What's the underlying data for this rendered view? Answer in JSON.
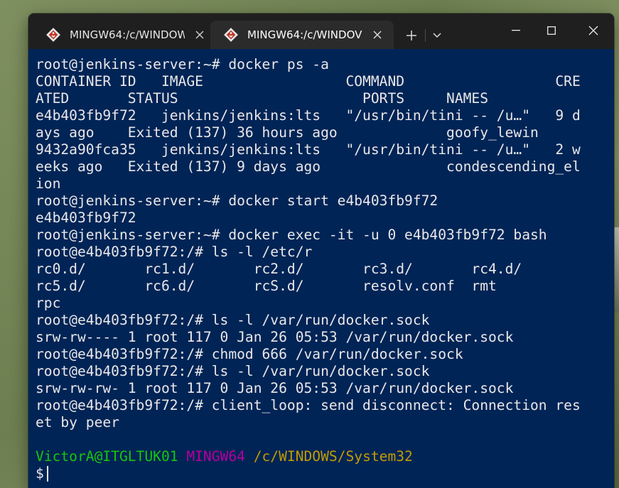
{
  "window": {
    "tabs": [
      {
        "title": "MINGW64:/c/WINDOW",
        "active": false
      },
      {
        "title": "MINGW64:/c/WINDOV",
        "active": true
      }
    ]
  },
  "colors": {
    "terminal_bg": "#012456",
    "prompt_user": "#16c60c",
    "prompt_system": "#b4009e",
    "prompt_path": "#c19c00"
  },
  "terminal": {
    "lines": [
      "root@jenkins-server:~# docker ps -a",
      "CONTAINER ID   IMAGE                 COMMAND                  CRE",
      "ATED       STATUS                      PORTS     NAMES",
      "e4b403fb9f72   jenkins/jenkins:lts   \"/usr/bin/tini -- /u…\"   9 d",
      "ays ago    Exited (137) 36 hours ago             goofy_lewin",
      "9432a90fca35   jenkins/jenkins:lts   \"/usr/bin/tini -- /u…\"   2 w",
      "eeks ago   Exited (137) 9 days ago               condescending_el",
      "ion",
      "root@jenkins-server:~# docker start e4b403fb9f72",
      "e4b403fb9f72",
      "root@jenkins-server:~# docker exec -it -u 0 e4b403fb9f72 bash",
      "root@e4b403fb9f72:/# ls -l /etc/r",
      "rc0.d/       rc1.d/       rc2.d/       rc3.d/       rc4.d/",
      "rc5.d/       rc6.d/       rcS.d/       resolv.conf  rmt",
      "rpc",
      "root@e4b403fb9f72:/# ls -l /var/run/docker.sock",
      "srw-rw---- 1 root 117 0 Jan 26 05:53 /var/run/docker.sock",
      "root@e4b403fb9f72:/# chmod 666 /var/run/docker.sock",
      "root@e4b403fb9f72:/# ls -l /var/run/docker.sock",
      "srw-rw-rw- 1 root 117 0 Jan 26 05:53 /var/run/docker.sock",
      "root@e4b403fb9f72:/# client_loop: send disconnect: Connection res",
      "et by peer",
      ""
    ],
    "prompt": {
      "user_host": "VictorA@ITGLTUK01",
      "system": "MINGW64",
      "path": "/c/WINDOWS/System32",
      "symbol": "$"
    }
  }
}
